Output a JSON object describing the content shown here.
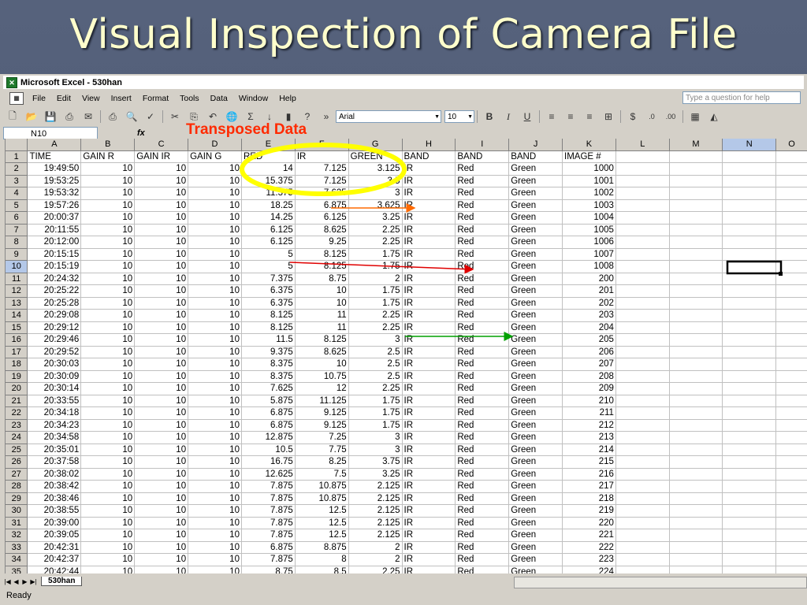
{
  "slide": {
    "title": "Visual Inspection of Camera File"
  },
  "window": {
    "title": "Microsoft Excel - 530han",
    "search_placeholder": "Type a question for help"
  },
  "menu": [
    "File",
    "Edit",
    "View",
    "Insert",
    "Format",
    "Tools",
    "Data",
    "Window",
    "Help"
  ],
  "toolbar": {
    "font": "Arial",
    "size": "10"
  },
  "formula": {
    "namebox": "N10",
    "fx": "fx"
  },
  "annotation": "Transposed Data",
  "columns": [
    "A",
    "B",
    "C",
    "D",
    "E",
    "F",
    "G",
    "H",
    "I",
    "J",
    "K",
    "L",
    "M",
    "N",
    "O"
  ],
  "rows": [
    [
      "TIME",
      "GAIN R",
      "GAIN IR",
      "GAIN G",
      "RED",
      "IR",
      "GREEN",
      "BAND",
      "BAND",
      "BAND",
      "IMAGE #"
    ],
    [
      "19:49:50",
      "10",
      "10",
      "10",
      "14",
      "7.125",
      "3.125",
      "IR",
      "Red",
      "Green",
      "1000"
    ],
    [
      "19:53:25",
      "10",
      "10",
      "10",
      "15.375",
      "7.125",
      "3.5",
      "IR",
      "Red",
      "Green",
      "1001"
    ],
    [
      "19:53:32",
      "10",
      "10",
      "10",
      "11.375",
      "7.625",
      "3",
      "IR",
      "Red",
      "Green",
      "1002"
    ],
    [
      "19:57:26",
      "10",
      "10",
      "10",
      "18.25",
      "6.875",
      "3.625",
      "IR",
      "Red",
      "Green",
      "1003"
    ],
    [
      "20:00:37",
      "10",
      "10",
      "10",
      "14.25",
      "6.125",
      "3.25",
      "IR",
      "Red",
      "Green",
      "1004"
    ],
    [
      "20:11:55",
      "10",
      "10",
      "10",
      "6.125",
      "8.625",
      "2.25",
      "IR",
      "Red",
      "Green",
      "1005"
    ],
    [
      "20:12:00",
      "10",
      "10",
      "10",
      "6.125",
      "9.25",
      "2.25",
      "IR",
      "Red",
      "Green",
      "1006"
    ],
    [
      "20:15:15",
      "10",
      "10",
      "10",
      "5",
      "8.125",
      "1.75",
      "IR",
      "Red",
      "Green",
      "1007"
    ],
    [
      "20:15:19",
      "10",
      "10",
      "10",
      "5",
      "8.125",
      "1.75",
      "IR",
      "Red",
      "Green",
      "1008"
    ],
    [
      "20:24:32",
      "10",
      "10",
      "10",
      "7.375",
      "8.75",
      "2",
      "IR",
      "Red",
      "Green",
      "200"
    ],
    [
      "20:25:22",
      "10",
      "10",
      "10",
      "6.375",
      "10",
      "1.75",
      "IR",
      "Red",
      "Green",
      "201"
    ],
    [
      "20:25:28",
      "10",
      "10",
      "10",
      "6.375",
      "10",
      "1.75",
      "IR",
      "Red",
      "Green",
      "202"
    ],
    [
      "20:29:08",
      "10",
      "10",
      "10",
      "8.125",
      "11",
      "2.25",
      "IR",
      "Red",
      "Green",
      "203"
    ],
    [
      "20:29:12",
      "10",
      "10",
      "10",
      "8.125",
      "11",
      "2.25",
      "IR",
      "Red",
      "Green",
      "204"
    ],
    [
      "20:29:46",
      "10",
      "10",
      "10",
      "11.5",
      "8.125",
      "3",
      "IR",
      "Red",
      "Green",
      "205"
    ],
    [
      "20:29:52",
      "10",
      "10",
      "10",
      "9.375",
      "8.625",
      "2.5",
      "IR",
      "Red",
      "Green",
      "206"
    ],
    [
      "20:30:03",
      "10",
      "10",
      "10",
      "8.375",
      "10",
      "2.5",
      "IR",
      "Red",
      "Green",
      "207"
    ],
    [
      "20:30:09",
      "10",
      "10",
      "10",
      "8.375",
      "10.75",
      "2.5",
      "IR",
      "Red",
      "Green",
      "208"
    ],
    [
      "20:30:14",
      "10",
      "10",
      "10",
      "7.625",
      "12",
      "2.25",
      "IR",
      "Red",
      "Green",
      "209"
    ],
    [
      "20:33:55",
      "10",
      "10",
      "10",
      "5.875",
      "11.125",
      "1.75",
      "IR",
      "Red",
      "Green",
      "210"
    ],
    [
      "20:34:18",
      "10",
      "10",
      "10",
      "6.875",
      "9.125",
      "1.75",
      "IR",
      "Red",
      "Green",
      "211"
    ],
    [
      "20:34:23",
      "10",
      "10",
      "10",
      "6.875",
      "9.125",
      "1.75",
      "IR",
      "Red",
      "Green",
      "212"
    ],
    [
      "20:34:58",
      "10",
      "10",
      "10",
      "12.875",
      "7.25",
      "3",
      "IR",
      "Red",
      "Green",
      "213"
    ],
    [
      "20:35:01",
      "10",
      "10",
      "10",
      "10.5",
      "7.75",
      "3",
      "IR",
      "Red",
      "Green",
      "214"
    ],
    [
      "20:37:58",
      "10",
      "10",
      "10",
      "16.75",
      "8.25",
      "3.75",
      "IR",
      "Red",
      "Green",
      "215"
    ],
    [
      "20:38:02",
      "10",
      "10",
      "10",
      "12.625",
      "7.5",
      "3.25",
      "IR",
      "Red",
      "Green",
      "216"
    ],
    [
      "20:38:42",
      "10",
      "10",
      "10",
      "7.875",
      "10.875",
      "2.125",
      "IR",
      "Red",
      "Green",
      "217"
    ],
    [
      "20:38:46",
      "10",
      "10",
      "10",
      "7.875",
      "10.875",
      "2.125",
      "IR",
      "Red",
      "Green",
      "218"
    ],
    [
      "20:38:55",
      "10",
      "10",
      "10",
      "7.875",
      "12.5",
      "2.125",
      "IR",
      "Red",
      "Green",
      "219"
    ],
    [
      "20:39:00",
      "10",
      "10",
      "10",
      "7.875",
      "12.5",
      "2.125",
      "IR",
      "Red",
      "Green",
      "220"
    ],
    [
      "20:39:05",
      "10",
      "10",
      "10",
      "7.875",
      "12.5",
      "2.125",
      "IR",
      "Red",
      "Green",
      "221"
    ],
    [
      "20:42:31",
      "10",
      "10",
      "10",
      "6.875",
      "8.875",
      "2",
      "IR",
      "Red",
      "Green",
      "222"
    ],
    [
      "20:42:37",
      "10",
      "10",
      "10",
      "7.875",
      "8",
      "2",
      "IR",
      "Red",
      "Green",
      "223"
    ],
    [
      "20:42:44",
      "10",
      "10",
      "10",
      "8.75",
      "8.5",
      "2.25",
      "IR",
      "Red",
      "Green",
      "224"
    ]
  ],
  "sheet_tab": "530han",
  "status": "Ready",
  "colors": {
    "annotation": "#ff2a00",
    "oval": "#ffff00",
    "arrow_orange": "#ff6a00",
    "arrow_red": "#e00000",
    "arrow_green": "#00a000",
    "title": "#ffffcc"
  }
}
